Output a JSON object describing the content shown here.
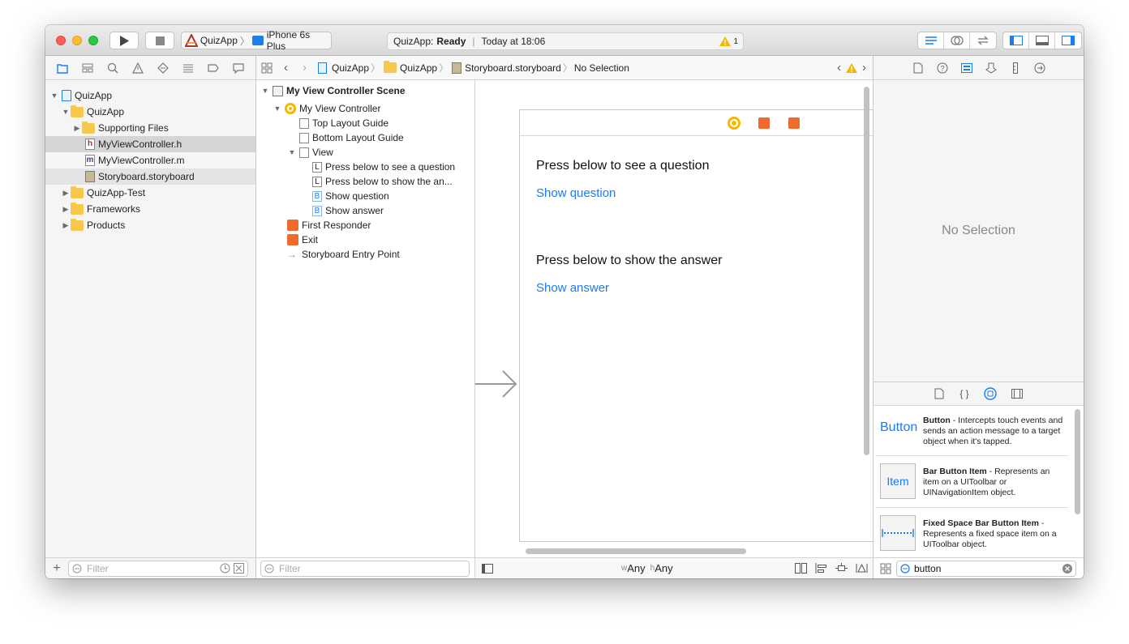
{
  "toolbar": {
    "scheme_app": "QuizApp",
    "scheme_device": "iPhone 6s Plus",
    "status_app": "QuizApp:",
    "status_state": "Ready",
    "status_time": "Today at 18:06",
    "warning_count": "1"
  },
  "jumpbar": {
    "crumbs": [
      "QuizApp",
      "QuizApp",
      "Storyboard.storyboard",
      "No Selection"
    ]
  },
  "navigator": {
    "items": [
      {
        "label": "QuizApp",
        "type": "project"
      },
      {
        "label": "QuizApp",
        "type": "folder"
      },
      {
        "label": "Supporting Files",
        "type": "folder"
      },
      {
        "label": "MyViewController.h",
        "type": "h"
      },
      {
        "label": "MyViewController.m",
        "type": "m"
      },
      {
        "label": "Storyboard.storyboard",
        "type": "storyboard"
      },
      {
        "label": "QuizApp-Test",
        "type": "folder"
      },
      {
        "label": "Frameworks",
        "type": "folder"
      },
      {
        "label": "Products",
        "type": "folder"
      }
    ],
    "filter_placeholder": "Filter"
  },
  "outline": {
    "scene": "My View Controller Scene",
    "items": [
      "My View Controller",
      "Top Layout Guide",
      "Bottom Layout Guide",
      "View",
      "Press below to see a question",
      "Press below to show the an...",
      "Show question",
      "Show answer",
      "First Responder",
      "Exit",
      "Storyboard Entry Point"
    ],
    "badges": [
      "L",
      "L",
      "B",
      "B"
    ],
    "filter_placeholder": "Filter"
  },
  "canvas": {
    "label1": "Press below to see a question",
    "button1": "Show question",
    "label2": "Press below to show the answer",
    "button2": "Show answer",
    "size_w_prefix": "w",
    "size_w": "Any",
    "size_h_prefix": "h",
    "size_h": "Any"
  },
  "inspector": {
    "no_selection": "No Selection"
  },
  "library": {
    "items": [
      {
        "icon": "Button",
        "title": "Button",
        "desc": " - Intercepts touch events and sends an action message to a target object when it's tapped."
      },
      {
        "icon": "Item",
        "title": "Bar Button Item",
        "desc": " - Represents an item on a UIToolbar or UINavigationItem object."
      },
      {
        "icon": "",
        "title": "Fixed Space Bar Button Item",
        "desc": " - Represents a fixed space item on a UIToolbar object."
      }
    ],
    "search_value": "button"
  },
  "colors": {
    "accent": "#1a7cf0",
    "warning": "#f5b800",
    "orange": "#ee6b2d",
    "folder": "#f6c94e"
  }
}
